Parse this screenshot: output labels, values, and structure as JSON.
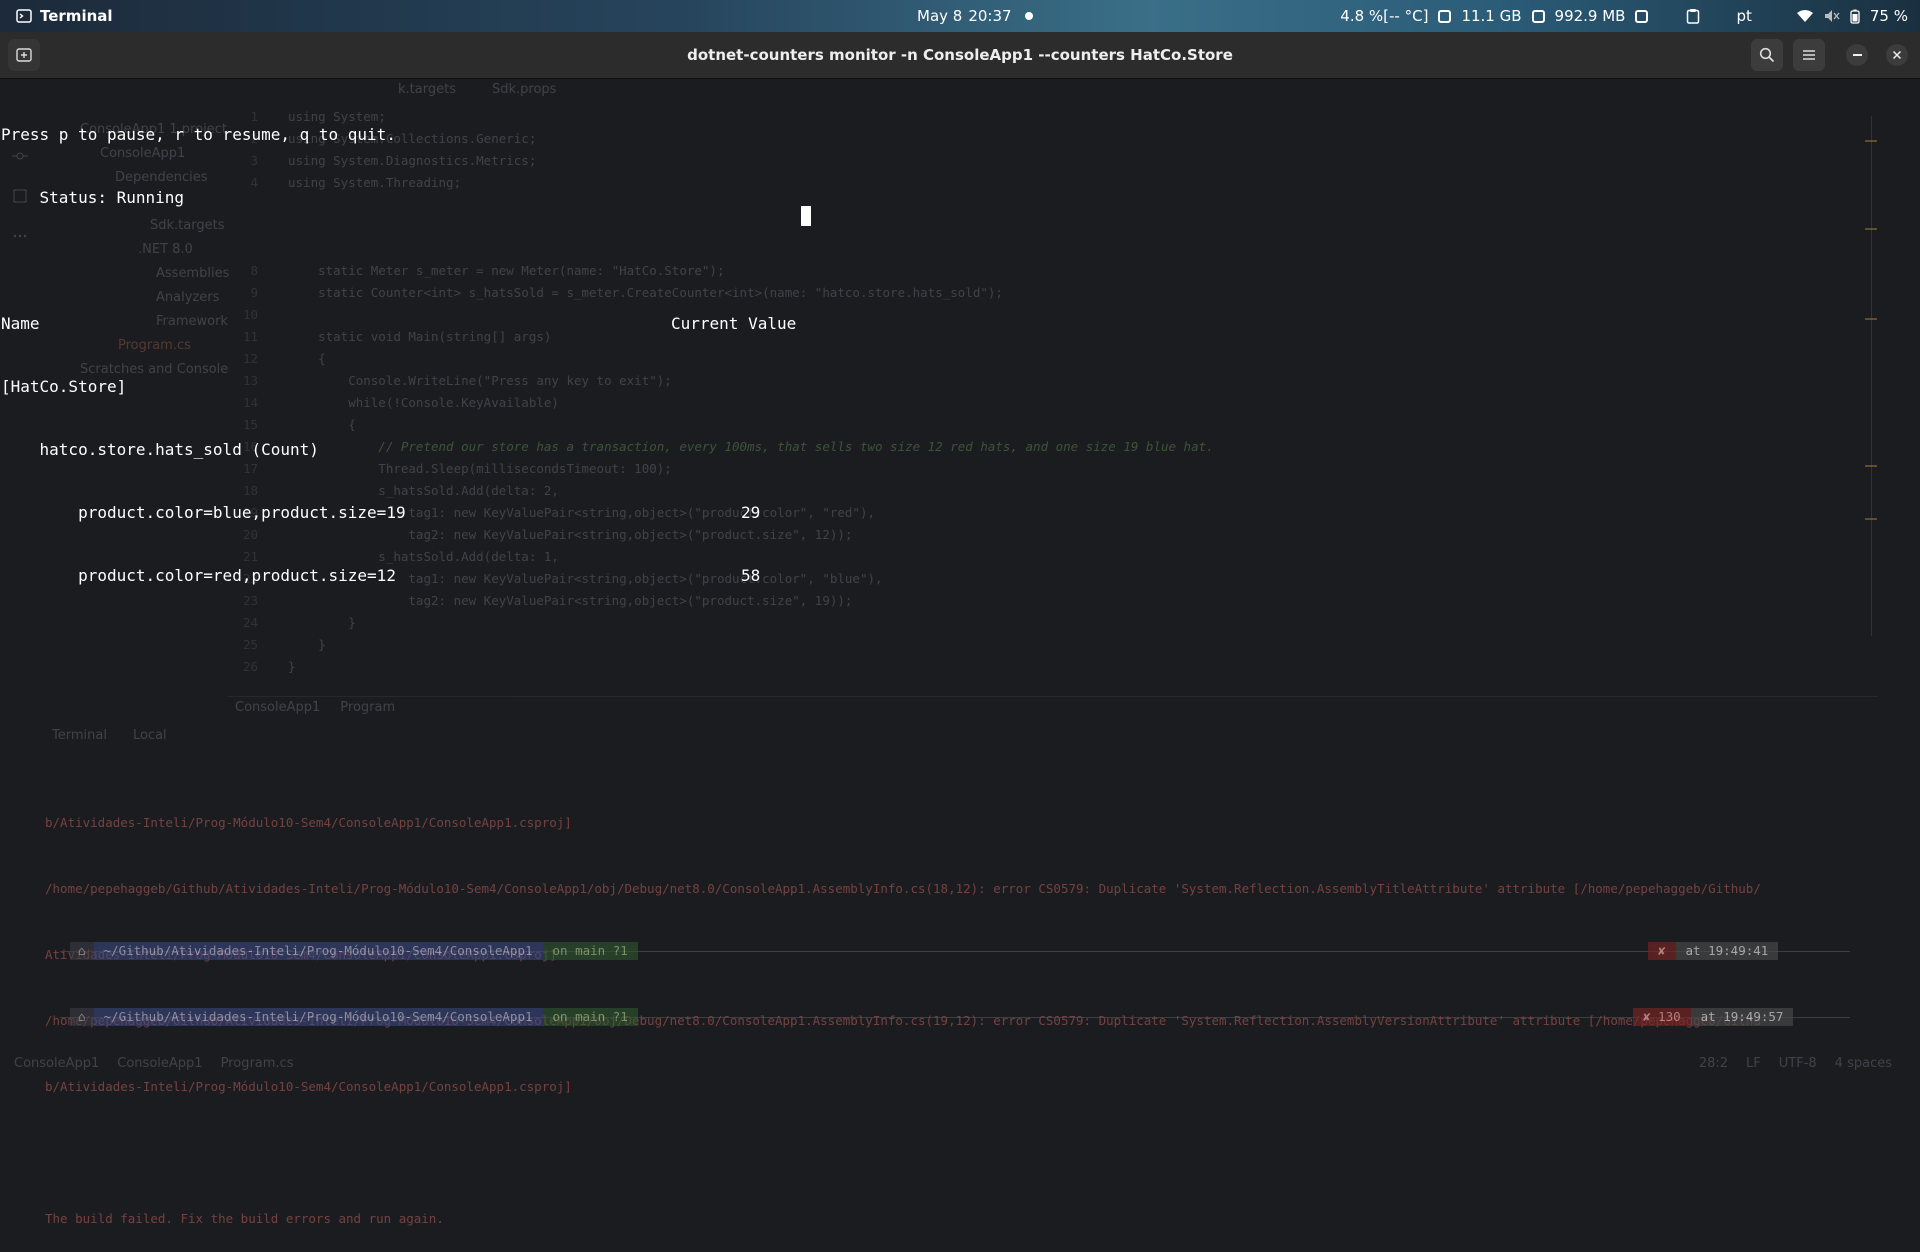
{
  "topbar": {
    "app_name": "Terminal",
    "date": "May 8",
    "time": "20:37",
    "cpu": "4.8 %[-- °C]",
    "memory": "11.1 GB",
    "swap": "992.9 MB",
    "keyboard_layout": "pt",
    "battery": "75 %"
  },
  "window": {
    "title": "dotnet-counters monitor -n ConsoleApp1 --counters HatCo.Store"
  },
  "terminal": {
    "line1": "Press p to pause, r to resume, q to quit.",
    "status_line": "    Status: Running",
    "header_name": "Name",
    "header_value": "Current Value",
    "provider": "[HatCo.Store]",
    "counter": "    hatco.store.hats_sold (Count)",
    "rows": [
      {
        "label": "        product.color=blue,product.size=19",
        "value": "29"
      },
      {
        "label": "        product.color=red,product.size=12",
        "value": "58"
      }
    ]
  },
  "ide_background": {
    "tabs": [
      "k.targets",
      "Sdk.props"
    ],
    "tree": [
      "ConsoleApp1  1 project",
      "ConsoleApp1",
      "Dependencies",
      "Sdk.targets",
      ".NET 8.0",
      "Assemblies",
      "Analyzers",
      "Framework",
      "Program.cs",
      "Scratches and Console"
    ],
    "code": [
      {
        "n": "1",
        "t": "using System;"
      },
      {
        "n": "2",
        "t": "using System.Collections.Generic;"
      },
      {
        "n": "3",
        "t": "using System.Diagnostics.Metrics;"
      },
      {
        "n": "4",
        "t": "using System.Threading;"
      },
      {
        "n": "8",
        "t": "    static Meter s_meter = new Meter(name: \"HatCo.Store\");"
      },
      {
        "n": "9",
        "t": "    static Counter<int> s_hatsSold = s_meter.CreateCounter<int>(name: \"hatco.store.hats_sold\");"
      },
      {
        "n": "10",
        "t": ""
      },
      {
        "n": "11",
        "t": "    static void Main(string[] args)"
      },
      {
        "n": "12",
        "t": "    {"
      },
      {
        "n": "13",
        "t": "        Console.WriteLine(\"Press any key to exit\");"
      },
      {
        "n": "14",
        "t": "        while(!Console.KeyAvailable)"
      },
      {
        "n": "15",
        "t": "        {"
      },
      {
        "n": "16",
        "t": "            // Pretend our store has a transaction, every 100ms, that sells two size 12 red hats, and one size 19 blue hat."
      },
      {
        "n": "17",
        "t": "            Thread.Sleep(millisecondsTimeout: 100);"
      },
      {
        "n": "18",
        "t": "            s_hatsSold.Add(delta: 2,"
      },
      {
        "n": "19",
        "t": "                tag1: new KeyValuePair<string,object>(\"product.color\", \"red\"),"
      },
      {
        "n": "20",
        "t": "                tag2: new KeyValuePair<string,object>(\"product.size\", 12));"
      },
      {
        "n": "21",
        "t": "            s_hatsSold.Add(delta: 1,"
      },
      {
        "n": "22",
        "t": "                tag1: new KeyValuePair<string,object>(\"product.color\", \"blue\"),"
      },
      {
        "n": "23",
        "t": "                tag2: new KeyValuePair<string,object>(\"product.size\", 19));"
      },
      {
        "n": "24",
        "t": "        }"
      },
      {
        "n": "25",
        "t": "    }"
      },
      {
        "n": "26",
        "t": "}"
      }
    ],
    "breadcrumb_tabs": [
      "ConsoleApp1",
      "Program"
    ],
    "tool_tabs": [
      "Terminal",
      "Local"
    ],
    "build_output": [
      "b/Atividades-Inteli/Prog-Módulo10-Sem4/ConsoleApp1/ConsoleApp1.csproj]",
      "/home/pepehaggeb/Github/Atividades-Inteli/Prog-Módulo10-Sem4/ConsoleApp1/obj/Debug/net8.0/ConsoleApp1.AssemblyInfo.cs(18,12): error CS0579: Duplicate 'System.Reflection.AssemblyTitleAttribute' attribute [/home/pepehaggeb/Github/",
      "Atividades-Inteli/Prog-Módulo10-Sem4/ConsoleApp1/ConsoleApp1.csproj]",
      "/home/pepehaggeb/Github/Atividades-Inteli/Prog-Módulo10-Sem4/ConsoleApp1/obj/Debug/net8.0/ConsoleApp1.AssemblyInfo.cs(19,12): error CS0579: Duplicate 'System.Reflection.AssemblyVersionAttribute' attribute [/home/pepehaggeb/Githu",
      "b/Atividades-Inteli/Prog-Módulo10-Sem4/ConsoleApp1/ConsoleApp1.csproj]",
      "",
      "The build failed. Fix the build errors and run again."
    ],
    "prompt_path": "~/Github/Atividades-Inteli/Prog-Módulo10-Sem4/ConsoleApp1",
    "prompt_branch": "on  main ?1",
    "prompt_times": [
      "at 19:49:41",
      "at 19:49:57"
    ],
    "status_left": [
      "ConsoleApp1",
      "ConsoleApp1",
      "Program.cs"
    ],
    "status_right": [
      "28:2",
      "LF",
      "UTF-8",
      "4 spaces"
    ]
  }
}
